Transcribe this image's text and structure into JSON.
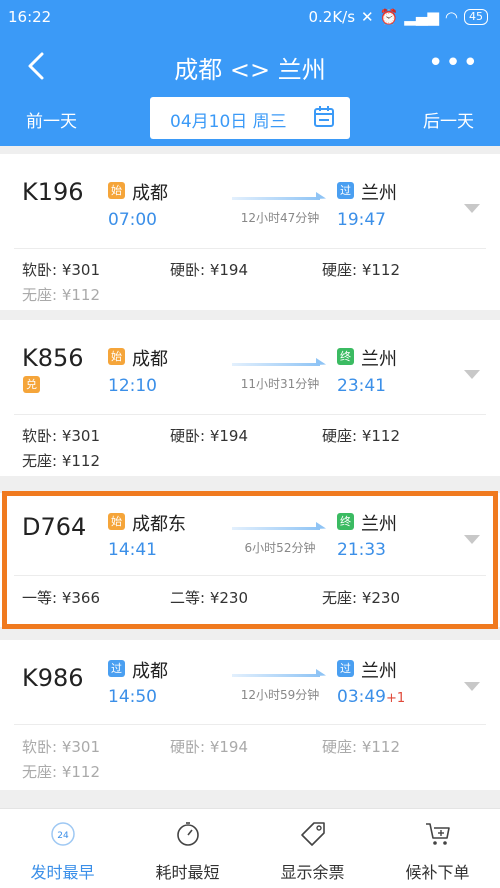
{
  "status_bar": {
    "time": "16:22",
    "network_speed": "0.2K/s",
    "battery": "45"
  },
  "header": {
    "title": "成都 <> 兰州",
    "back_icon": "back-arrow-icon",
    "more_icon": "more-dots-icon"
  },
  "date_bar": {
    "prev_label": "前一天",
    "date": "04月10日 周三",
    "next_label": "后一天"
  },
  "trains": [
    {
      "train_no": "K196",
      "badge": "",
      "from_tag": "始",
      "from_station": "成都",
      "depart_time": "07:00",
      "duration": "12小时47分钟",
      "to_tag": "过",
      "to_station": "兰州",
      "arrive_time": "19:47",
      "next_day": "",
      "seats": [
        "软卧: ¥301",
        "硬卧: ¥194",
        "硬座: ¥112",
        "无座: ¥112"
      ]
    },
    {
      "train_no": "K856",
      "badge": "兑",
      "from_tag": "始",
      "from_station": "成都",
      "depart_time": "12:10",
      "duration": "11小时31分钟",
      "to_tag": "终",
      "to_station": "兰州",
      "arrive_time": "23:41",
      "next_day": "",
      "seats": [
        "软卧: ¥301",
        "硬卧: ¥194",
        "硬座: ¥112",
        "无座: ¥112"
      ]
    },
    {
      "train_no": "D764",
      "badge": "",
      "from_tag": "始",
      "from_station": "成都东",
      "depart_time": "14:41",
      "duration": "6小时52分钟",
      "to_tag": "终",
      "to_station": "兰州",
      "arrive_time": "21:33",
      "next_day": "",
      "seats": [
        "一等: ¥366",
        "二等: ¥230",
        "无座: ¥230"
      ]
    },
    {
      "train_no": "K986",
      "badge": "",
      "from_tag": "过",
      "from_station": "成都",
      "depart_time": "14:50",
      "duration": "12小时59分钟",
      "to_tag": "过",
      "to_station": "兰州",
      "arrive_time": "03:49",
      "next_day": "+1",
      "seats": [
        "软卧: ¥301",
        "硬卧: ¥194",
        "硬座: ¥112",
        "无座: ¥112"
      ]
    }
  ],
  "tabs": [
    {
      "label": "发时最早",
      "icon": "clock-24-icon",
      "icon_text": "24",
      "active": true
    },
    {
      "label": "耗时最短",
      "icon": "stopwatch-icon",
      "active": false
    },
    {
      "label": "显示余票",
      "icon": "ticket-tag-icon",
      "active": false
    },
    {
      "label": "候补下单",
      "icon": "cart-plus-icon",
      "active": false
    }
  ],
  "colors": {
    "primary": "#3b9af7",
    "highlight": "#f07a1f",
    "time": "#3b8fe8",
    "tag_start": "#f5a53a",
    "tag_pass": "#4a9ff1",
    "tag_end": "#3bbb62"
  }
}
